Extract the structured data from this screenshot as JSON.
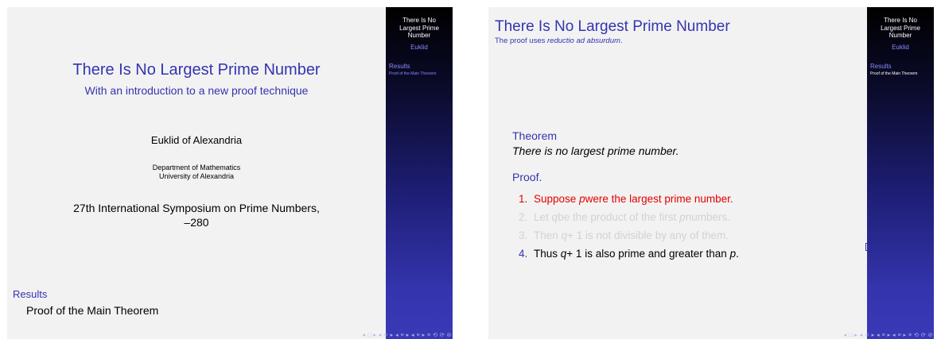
{
  "colors": {
    "accent": "#3434b2",
    "sidebar_dark": "#000000",
    "sidebar_light": "#3a3ab8",
    "alert": "#e60000",
    "faded": "#d2d2d2"
  },
  "sidebar": {
    "title_lines": [
      "There Is No",
      "Largest Prime",
      "Number"
    ],
    "author": "Euklid",
    "section": "Results",
    "subsection": "Proof of the Main Theorem"
  },
  "navbar": {
    "symbols": "◂ □ ▸ ◂ ⟐ ▸ ◂ ≡ ▸ ◂ ≡ ▸   ≡   ⟲ ⟳ ⊘"
  },
  "slide1": {
    "title": "There Is No Largest Prime Number",
    "subtitle": "With an introduction to a new proof technique",
    "author": "Euklid of Alexandria",
    "institute_line1": "Department of Mathematics",
    "institute_line2": "University of Alexandria",
    "conference_line1": "27th International Symposium on Prime Numbers,",
    "conference_line2": "–280",
    "toc_section": "Results",
    "toc_subsection": "Proof of the Main Theorem"
  },
  "slide2": {
    "frame_title": "There Is No Largest Prime Number",
    "frame_subtitle_prefix": "The proof uses ",
    "frame_subtitle_italic": "reductio ad absurdum",
    "frame_subtitle_suffix": ".",
    "theorem_heading": "Theorem",
    "theorem_body": "There is no largest prime number.",
    "proof_heading": "Proof.",
    "steps": [
      {
        "num": "1.",
        "a": "Suppose ",
        "var": "p",
        "b": " were the largest prime number."
      },
      {
        "num": "2.",
        "a": "Let ",
        "var": "q",
        "b": " be the product of the first ",
        "var2": "p",
        "c": " numbers."
      },
      {
        "num": "3.",
        "a": "Then ",
        "var": "q",
        "b": " + 1 is not divisible by any of them."
      },
      {
        "num": "4.",
        "a": "Thus ",
        "var": "q",
        "b": " + 1 is also prime and greater than ",
        "var2": "p",
        "c": "."
      }
    ]
  }
}
